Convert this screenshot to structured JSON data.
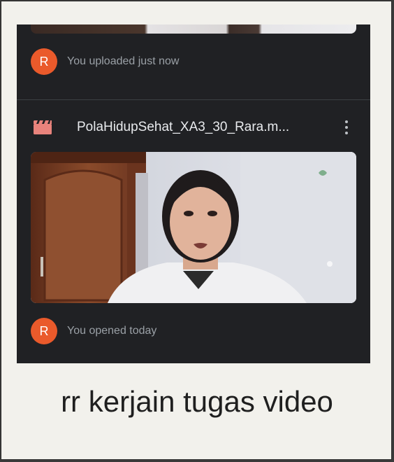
{
  "activity_uploaded": {
    "avatar_letter": "R",
    "text": "You uploaded just now"
  },
  "file": {
    "name": "PolaHidupSehat_XA3_30_Rara.m...",
    "icon": "video-file-icon",
    "more_icon": "more-vert-icon"
  },
  "activity_opened": {
    "avatar_letter": "R",
    "text": "You opened today"
  },
  "caption": "rr kerjain tugas video",
  "colors": {
    "avatar": "#ea5a2b",
    "screen_bg": "#202124",
    "file_icon": "#e8837c",
    "card_bg": "#f2f1ec"
  }
}
